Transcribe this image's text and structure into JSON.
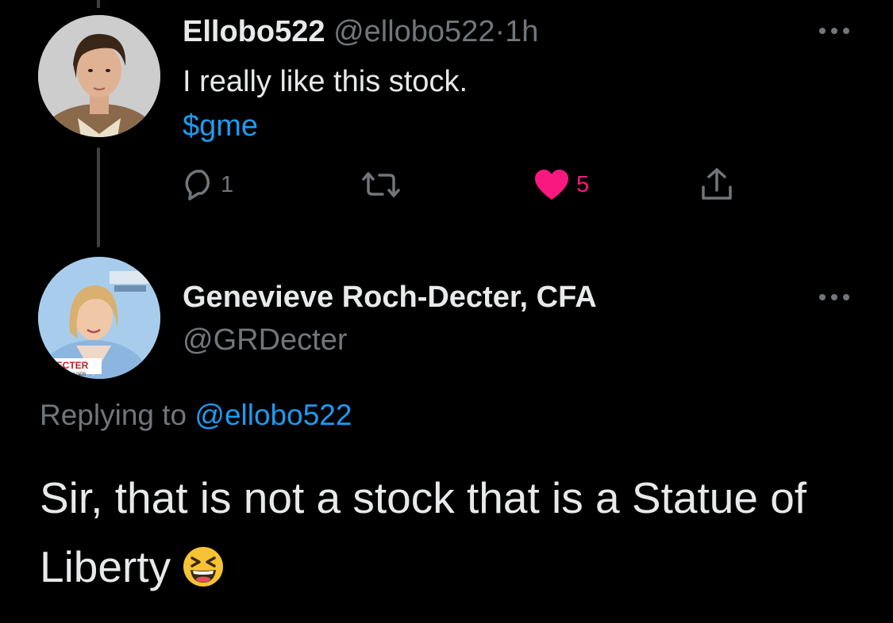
{
  "tweet": {
    "display_name": "Ellobo522",
    "handle": "@ellobo522",
    "separator": "·",
    "time": "1h",
    "text": "I really like this stock.",
    "cashtag": "$gme",
    "reply_count": "1",
    "like_count": "5",
    "avatar_icon": "profile-photo-young-man"
  },
  "reply": {
    "display_name": "Genevieve Roch-Decter, CFA",
    "handle": "@GRDecter",
    "replying_prefix": "Replying to",
    "replying_to": "@ellobo522",
    "text": "Sir, that is not a stock that is a Statue of Liberty",
    "emoji_icon": "grinning-squinting-face-emoji",
    "avatar_caption": "-DECTER",
    "avatar_subcaption": "MANAGER",
    "avatar_icon": "profile-photo-woman-tv"
  },
  "colors": {
    "background": "#000000",
    "text": "#e7e9ea",
    "muted": "#71767b",
    "link": "#1d9bf0",
    "like": "#f91880"
  },
  "icons": {
    "reply": "reply-icon",
    "retweet": "retweet-icon",
    "like": "heart-icon",
    "share": "share-icon",
    "more": "more-icon"
  }
}
